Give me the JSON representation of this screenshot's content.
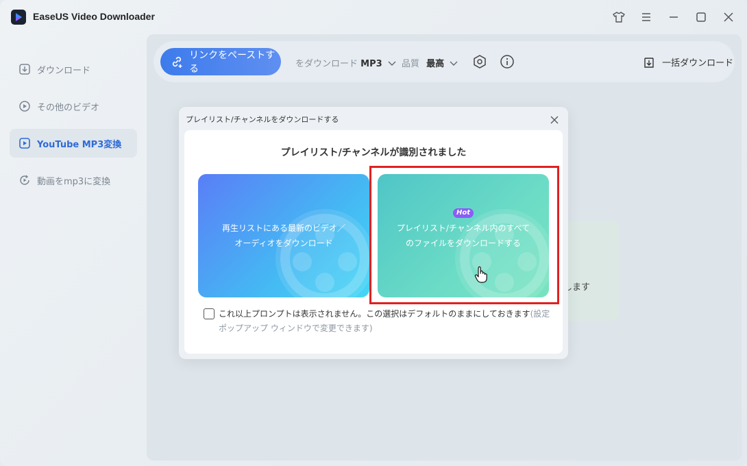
{
  "app": {
    "title": "EaseUS Video Downloader"
  },
  "sidebar": {
    "items": [
      {
        "label": "ダウンロード",
        "icon": "download-icon",
        "active": false
      },
      {
        "label": "その他のビデオ",
        "icon": "play-circle-icon",
        "active": false
      },
      {
        "label": "YouTube MP3変換",
        "icon": "play-square-icon",
        "active": true
      },
      {
        "label": "動画をmp3に変換",
        "icon": "convert-icon",
        "active": false
      }
    ]
  },
  "toolbar": {
    "paste_label": "リンクをペーストする",
    "download_as_label": "をダウンロード",
    "download_as_value": "MP3",
    "quality_label": "品質",
    "quality_value": "最高",
    "batch_label": "一括ダウンロード"
  },
  "background": {
    "partial_text": "します"
  },
  "dialog": {
    "title": "プレイリスト/チャンネルをダウンロードする",
    "heading": "プレイリスト/チャンネルが識別されました",
    "option_left": {
      "line1": "再生リストにある最新のビデオ／",
      "line2": "オーディオをダウンロード"
    },
    "option_right": {
      "badge": "Hot",
      "line1": "プレイリスト/チャンネル内のすべて",
      "line2": "のファイルをダウンロードする"
    },
    "checkbox_text": "これ以上プロンプトは表示されません。この選択はデフォルトのままにしておきます",
    "checkbox_link": "(設定ポップアップ ウィンドウで変更できます)"
  },
  "colors": {
    "accent": "#3d7bec",
    "highlight": "#e02020",
    "hot_badge": "#8b5cf6"
  }
}
